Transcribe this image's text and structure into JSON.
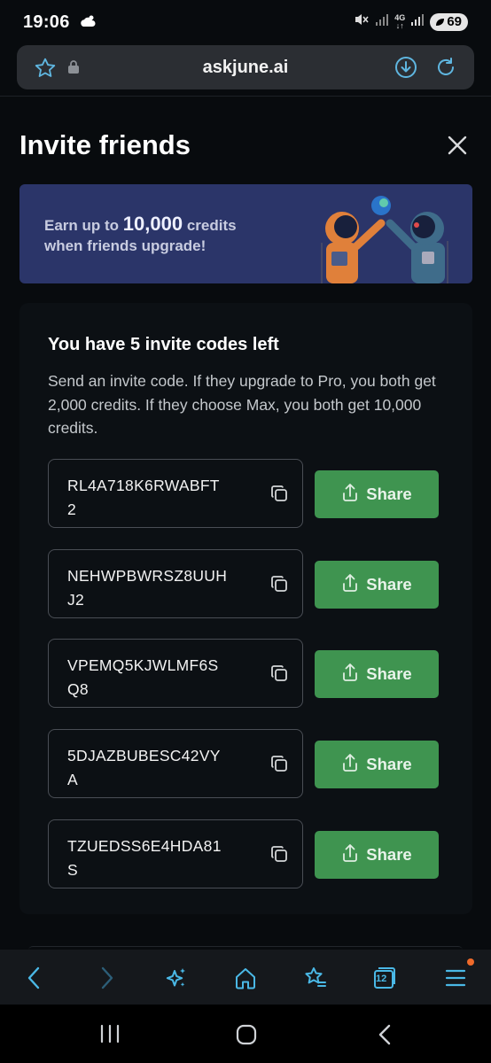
{
  "status_bar": {
    "time": "19:06",
    "battery": "69",
    "network": "4G"
  },
  "browser": {
    "domain": "askjune.ai",
    "tabs_count": "12"
  },
  "page": {
    "title": "Invite friends"
  },
  "banner": {
    "line1_prefix": "Earn up to",
    "line1_amount": "10,000",
    "line1_suffix": "credits",
    "line2": "when friends upgrade!"
  },
  "invite": {
    "title": "You have 5 invite codes left",
    "description": "Send an invite code. If they upgrade to Pro, you both get 2,000 credits. If they choose Max, you both get 10,000 credits.",
    "share_label": "Share",
    "codes": [
      {
        "line1": "RL4A718K6RWABFT",
        "line2": "2"
      },
      {
        "line1": "NEHWPBWRSZ8UUH",
        "line2": "J2"
      },
      {
        "line1": "VPEMQ5KJWLMF6S",
        "line2": "Q8"
      },
      {
        "line1": "5DJAZBUBESC42VY",
        "line2": "A"
      },
      {
        "line1": "TZUEDSS6E4HDA81",
        "line2": "S"
      }
    ]
  },
  "colors": {
    "background": "#080b0e",
    "banner": "#2b3569",
    "share_button": "#3f9450",
    "accent_icon": "#4ab8e6"
  },
  "icons": {
    "star": "star-outline-icon",
    "lock": "lock-icon",
    "download": "download-icon",
    "reload": "reload-icon",
    "close": "close-icon",
    "copy": "copy-icon",
    "share": "share-upload-icon",
    "back": "chevron-left-icon",
    "forward": "chevron-right-icon",
    "ai": "sparkle-icon",
    "home": "home-icon",
    "bookmarks": "star-list-icon",
    "tabs": "tabs-icon",
    "menu": "menu-icon"
  }
}
